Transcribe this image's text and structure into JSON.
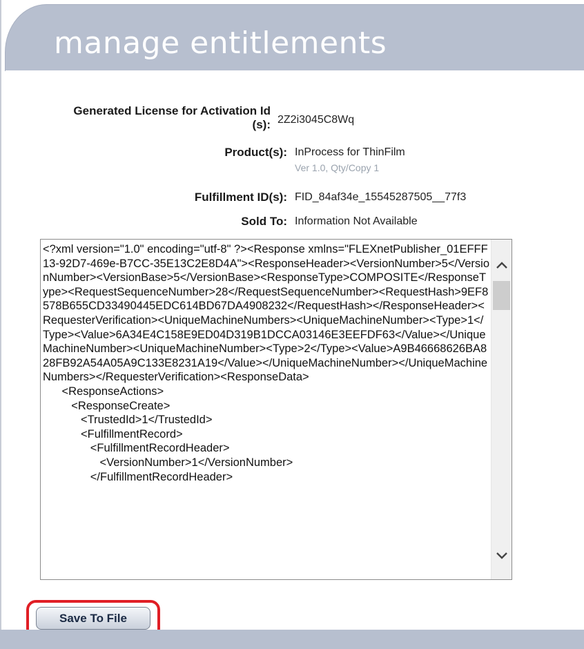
{
  "header": {
    "title": "manage entitlements"
  },
  "details": {
    "activation_label_line1": "Generated License for Activation Id",
    "activation_label_line2": "(s):",
    "activation_value": "2Z2i3045C8Wq",
    "product_label": "Product(s):",
    "product_value": "InProcess for ThinFilm",
    "product_sub": "Ver 1.0, Qty/Copy 1",
    "fulfillment_label": "Fulfillment ID(s):",
    "fulfillment_value": "FID_84af34e_15545287505__77f3",
    "sold_to_label": "Sold To:",
    "sold_to_value": "Information Not Available"
  },
  "license_xml": "<?xml version=\"1.0\" encoding=\"utf-8\" ?><Response xmlns=\"FLEXnetPublisher_01EFFF13-92D7-469e-B7CC-35E13C2E8D4A\"><ResponseHeader><VersionNumber>5</VersionNumber><VersionBase>5</VersionBase><ResponseType>COMPOSITE</ResponseType><RequestSequenceNumber>28</RequestSequenceNumber><RequestHash>9EF8578B655CD33490445EDC614BD67DA4908232</RequestHash></ResponseHeader><RequesterVerification><UniqueMachineNumbers><UniqueMachineNumber><Type>1</Type><Value>6A34E4C158E9ED04D319B1DCCA03146E3EEFDF63</Value></UniqueMachineNumber><UniqueMachineNumber><Type>2</Type><Value>A9B46668626BA828FB92A54A05A9C133E8231A19</Value></UniqueMachineNumber></UniqueMachineNumbers></RequesterVerification><ResponseData>\n      <ResponseActions>\n         <ResponseCreate>\n            <TrustedId>1</TrustedId>\n            <FulfillmentRecord>\n               <FulfillmentRecordHeader>\n                  <VersionNumber>1</VersionNumber>\n               </FulfillmentRecordHeader>",
  "actions": {
    "save_label": "Save To File"
  },
  "icons": {
    "scroll_up": "chevron-up-icon",
    "scroll_down": "chevron-down-icon"
  },
  "colors": {
    "header_bg": "#b7bfcf",
    "highlight_ring": "#e01e25"
  }
}
